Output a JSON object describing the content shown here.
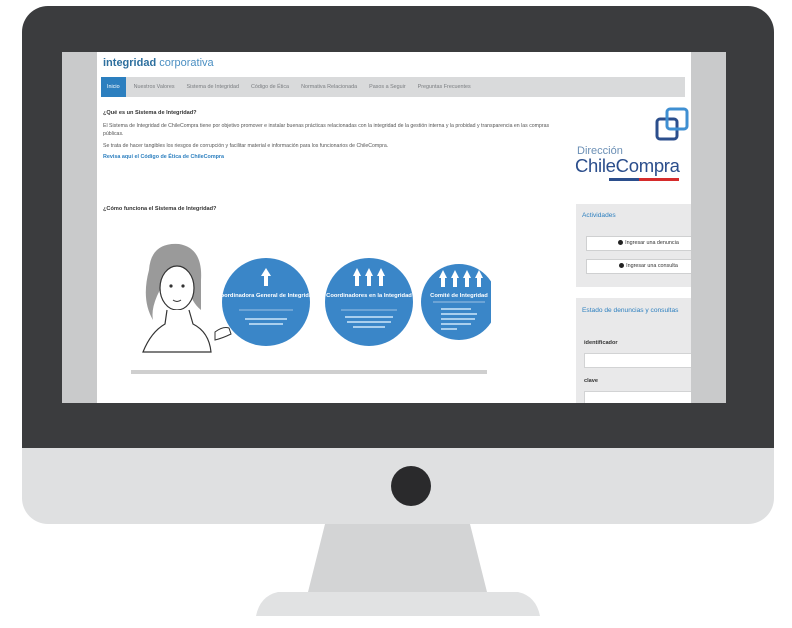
{
  "site": {
    "brand_strong": "integridad",
    "brand_light": "corporativa"
  },
  "nav": {
    "items": [
      "Inicio",
      "Nuestros Valores",
      "Sistema de Integridad",
      "Código de Ética",
      "Normativa Relacionada",
      "Pasos a Seguir",
      "Preguntas Frecuentes"
    ]
  },
  "main": {
    "question_title": "¿Qué es un Sistema de Integridad?",
    "paragraph1": "El Sistema de Integridad de ChileCompra tiene por objetivo promover e instalar buenas prácticas relacionadas con la integridad de la gestión interna y la probidad y transparencia en las compras públicas.",
    "paragraph2": "Se trata de hacer tangibles los riesgos de corrupción y facilitar material e información para los funcionarios de ChileCompra.",
    "code_link": "Revisa aquí el Código de Ética de ChileCompra",
    "how_title": "¿Cómo funciona el Sistema de Integridad?"
  },
  "infographic": {
    "circles": [
      {
        "title": "Coordinadora General de Integridad"
      },
      {
        "title": "Coordinadores en la Integridad"
      },
      {
        "title": "Comité de Integridad"
      }
    ]
  },
  "logo": {
    "small": "Dirección",
    "big": "ChileCompra"
  },
  "sidebar": {
    "activities_title": "Actividades",
    "btn_denuncia": "Ingresar una denuncia",
    "btn_consulta": "Ingresar una consulta",
    "status_title": "Estado de denuncias y consultas",
    "identifier_label": "identificador",
    "password_label": "clave"
  },
  "colors": {
    "accent": "#2c7fbf",
    "circle": "#3a86c8",
    "logo": "#2b4e8c",
    "bezel": "#3b3c3e"
  }
}
